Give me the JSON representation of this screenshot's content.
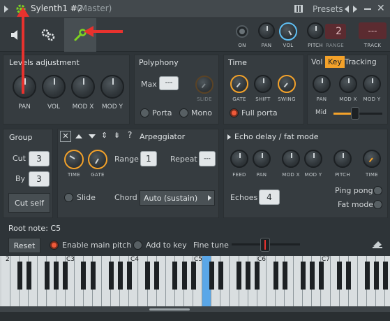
{
  "titlebar": {
    "title": "Sylenth1 #2",
    "subtitle": "(Master)",
    "presets": "Presets"
  },
  "toolbar": {
    "knobs": [
      {
        "label": "ON"
      },
      {
        "label": "PAN"
      },
      {
        "label": "VOL"
      },
      {
        "label": "PITCH"
      },
      {
        "label": "RANGE"
      }
    ],
    "range_value": "2",
    "track_label": "TRACK",
    "track_value": "---"
  },
  "levels": {
    "title": "Levels adjustment",
    "knobs": [
      "PAN",
      "VOL",
      "MOD X",
      "MOD Y"
    ]
  },
  "polyphony": {
    "title": "Polyphony",
    "max_label": "Max",
    "max_value": "---",
    "slide_label": "SLIDE",
    "porta_label": "Porta",
    "mono_label": "Mono"
  },
  "time": {
    "title": "Time",
    "knobs": [
      "GATE",
      "SHIFT",
      "SWING"
    ],
    "full_porta_label": "Full porta"
  },
  "voltabs": {
    "vol": "Vol",
    "key": "Key",
    "tracking": "Tracking",
    "knobs": [
      "PAN",
      "MOD X",
      "MOD Y"
    ],
    "mid_label": "Mid"
  },
  "group": {
    "title": "Group",
    "cut_label": "Cut",
    "cut_value": "3",
    "by_label": "By",
    "by_value": "3",
    "cut_self": "Cut self"
  },
  "arp": {
    "title": "Arpeggiator",
    "knobs": [
      "TIME",
      "GATE"
    ],
    "range_label": "Range",
    "range_value": "1",
    "repeat_label": "Repeat",
    "repeat_value": "---",
    "slide_label": "Slide",
    "chord_label": "Chord",
    "chord_value": "Auto (sustain)"
  },
  "echo": {
    "title": "Echo delay / fat mode",
    "knobs": [
      "FEED",
      "PAN",
      "MOD X",
      "MOD Y",
      "PITCH",
      "TIME"
    ],
    "echoes_label": "Echoes",
    "echoes_value": "4",
    "ping_pong": "Ping pong",
    "fat_mode": "Fat mode"
  },
  "root": {
    "title": "Root note: C5",
    "reset": "Reset",
    "enable_main_pitch": "Enable main pitch",
    "add_to_key": "Add to key",
    "fine_tune": "Fine tune"
  },
  "piano": {
    "octave_labels": [
      "2",
      "C3",
      "C4",
      "C5",
      "C6",
      "C7"
    ]
  },
  "colors": {
    "accent_orange": "#f4a22a",
    "accent_blue": "#5fbef2",
    "highlight_key": "#5aa7e8",
    "annotation_red": "#e8322e"
  }
}
